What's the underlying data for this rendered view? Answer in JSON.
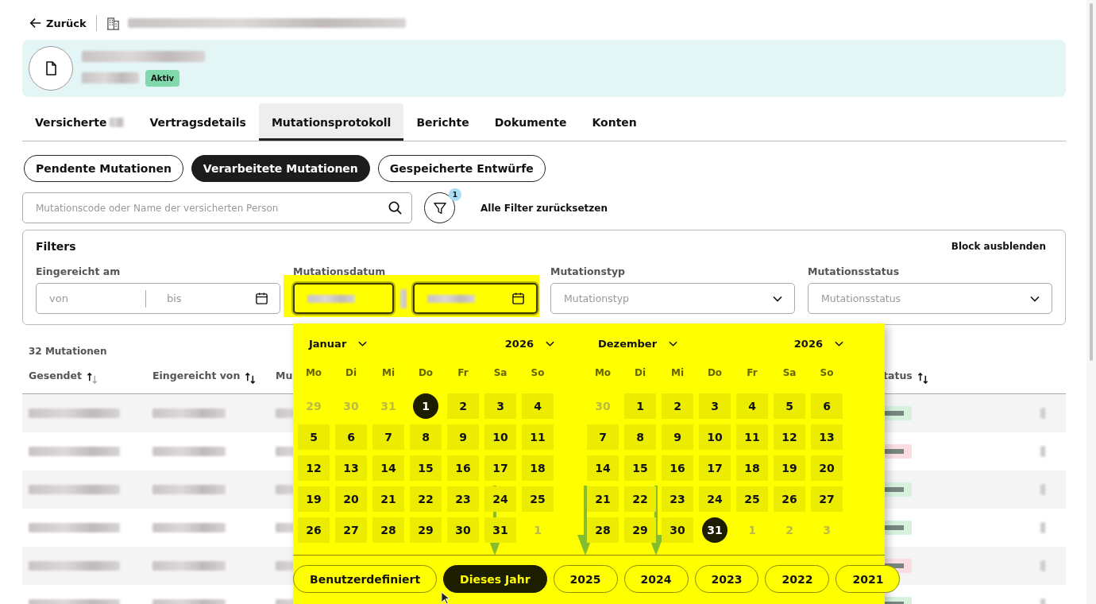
{
  "back_link": {
    "label": "Zurück"
  },
  "header": {
    "status_badge": "Aktiv"
  },
  "tabs": [
    {
      "label": "Versicherte",
      "count_redacted": true,
      "selected": false
    },
    {
      "label": "Vertragsdetails",
      "count_redacted": false,
      "selected": false
    },
    {
      "label": "Mutationsprotokoll",
      "count_redacted": false,
      "selected": true
    },
    {
      "label": "Berichte",
      "count_redacted": false,
      "selected": false
    },
    {
      "label": "Dokumente",
      "count_redacted": false,
      "selected": false
    },
    {
      "label": "Konten",
      "count_redacted": false,
      "selected": false
    }
  ],
  "view_toggle": [
    {
      "label": "Pendente Mutationen",
      "selected": false
    },
    {
      "label": "Verarbeitete Mutationen",
      "selected": true
    },
    {
      "label": "Gespeicherte Entwürfe",
      "selected": false
    }
  ],
  "search": {
    "placeholder": "Mutationscode oder Name der versicherten Person"
  },
  "filter_button": {
    "badge": "1"
  },
  "reset_link": "Alle Filter zurücksetzen",
  "filters": {
    "title": "Filters",
    "hide_link": "Block ausblenden",
    "fields": [
      {
        "kind": "range",
        "label": "Eingereicht am",
        "from_placeholder": "von",
        "to_placeholder": "bis",
        "highlighted": false
      },
      {
        "kind": "range_filled",
        "label": "Mutationsdatum",
        "highlighted": true
      },
      {
        "kind": "select",
        "label": "Mutationstyp",
        "placeholder": "Mutationstyp"
      },
      {
        "kind": "select",
        "label": "Mutationsstatus",
        "placeholder": "Mutationsstatus"
      }
    ]
  },
  "table": {
    "count": "32 Mutationen",
    "columns": [
      {
        "label": "Gesendet",
        "sorted": true
      },
      {
        "label": "Eingereicht von",
        "sorted": false
      },
      {
        "label": "Mu"
      },
      {
        "label": "tatus",
        "sorted": false
      }
    ],
    "rows": [
      {
        "color": "#d6f2dc"
      },
      {
        "color": "#f9dde2"
      },
      {
        "color": "#d6f2dc"
      },
      {
        "color": "#d6f2dc"
      },
      {
        "color": "#f9dde2"
      },
      {
        "color": "#d6f2dc"
      }
    ]
  },
  "datepicker": {
    "months": [
      {
        "month": "Januar",
        "year": "2026",
        "weekdays": [
          "Mo",
          "Di",
          "Mi",
          "Do",
          "Fr",
          "Sa",
          "So"
        ],
        "weeks": [
          [
            {
              "label": "29",
              "outside": true,
              "selected": false
            },
            {
              "label": "30",
              "outside": true,
              "selected": false
            },
            {
              "label": "31",
              "outside": true,
              "selected": false
            },
            {
              "label": "1",
              "outside": false,
              "selected": true
            },
            {
              "label": "2",
              "outside": false,
              "selected": false
            },
            {
              "label": "3",
              "outside": false,
              "selected": false
            },
            {
              "label": "4",
              "outside": false,
              "selected": false
            }
          ],
          [
            {
              "label": "5",
              "outside": false,
              "selected": false
            },
            {
              "label": "6",
              "outside": false,
              "selected": false
            },
            {
              "label": "7",
              "outside": false,
              "selected": false
            },
            {
              "label": "8",
              "outside": false,
              "selected": false
            },
            {
              "label": "9",
              "outside": false,
              "selected": false
            },
            {
              "label": "10",
              "outside": false,
              "selected": false
            },
            {
              "label": "11",
              "outside": false,
              "selected": false
            }
          ],
          [
            {
              "label": "12",
              "outside": false,
              "selected": false
            },
            {
              "label": "13",
              "outside": false,
              "selected": false
            },
            {
              "label": "14",
              "outside": false,
              "selected": false
            },
            {
              "label": "15",
              "outside": false,
              "selected": false
            },
            {
              "label": "16",
              "outside": false,
              "selected": false
            },
            {
              "label": "17",
              "outside": false,
              "selected": false
            },
            {
              "label": "18",
              "outside": false,
              "selected": false
            }
          ],
          [
            {
              "label": "19",
              "outside": false,
              "selected": false
            },
            {
              "label": "20",
              "outside": false,
              "selected": false
            },
            {
              "label": "21",
              "outside": false,
              "selected": false
            },
            {
              "label": "22",
              "outside": false,
              "selected": false
            },
            {
              "label": "23",
              "outside": false,
              "selected": false
            },
            {
              "label": "24",
              "outside": false,
              "selected": false
            },
            {
              "label": "25",
              "outside": false,
              "selected": false
            }
          ],
          [
            {
              "label": "26",
              "outside": false,
              "selected": false
            },
            {
              "label": "27",
              "outside": false,
              "selected": false
            },
            {
              "label": "28",
              "outside": false,
              "selected": false
            },
            {
              "label": "29",
              "outside": false,
              "selected": false
            },
            {
              "label": "30",
              "outside": false,
              "selected": false
            },
            {
              "label": "31",
              "outside": false,
              "selected": false
            },
            {
              "label": "1",
              "outside": true,
              "selected": false
            }
          ]
        ]
      },
      {
        "month": "Dezember",
        "year": "2026",
        "weekdays": [
          "Mo",
          "Di",
          "Mi",
          "Do",
          "Fr",
          "Sa",
          "So"
        ],
        "weeks": [
          [
            {
              "label": "30",
              "outside": true,
              "selected": false
            },
            {
              "label": "1",
              "outside": false,
              "selected": false
            },
            {
              "label": "2",
              "outside": false,
              "selected": false
            },
            {
              "label": "3",
              "outside": false,
              "selected": false
            },
            {
              "label": "4",
              "outside": false,
              "selected": false
            },
            {
              "label": "5",
              "outside": false,
              "selected": false
            },
            {
              "label": "6",
              "outside": false,
              "selected": false
            }
          ],
          [
            {
              "label": "7",
              "outside": false,
              "selected": false
            },
            {
              "label": "8",
              "outside": false,
              "selected": false
            },
            {
              "label": "9",
              "outside": false,
              "selected": false
            },
            {
              "label": "10",
              "outside": false,
              "selected": false
            },
            {
              "label": "11",
              "outside": false,
              "selected": false
            },
            {
              "label": "12",
              "outside": false,
              "selected": false
            },
            {
              "label": "13",
              "outside": false,
              "selected": false
            }
          ],
          [
            {
              "label": "14",
              "outside": false,
              "selected": false
            },
            {
              "label": "15",
              "outside": false,
              "selected": false
            },
            {
              "label": "16",
              "outside": false,
              "selected": false
            },
            {
              "label": "17",
              "outside": false,
              "selected": false
            },
            {
              "label": "18",
              "outside": false,
              "selected": false
            },
            {
              "label": "19",
              "outside": false,
              "selected": false
            },
            {
              "label": "20",
              "outside": false,
              "selected": false
            }
          ],
          [
            {
              "label": "21",
              "outside": false,
              "selected": false
            },
            {
              "label": "22",
              "outside": false,
              "selected": false
            },
            {
              "label": "23",
              "outside": false,
              "selected": false
            },
            {
              "label": "24",
              "outside": false,
              "selected": false
            },
            {
              "label": "25",
              "outside": false,
              "selected": false
            },
            {
              "label": "26",
              "outside": false,
              "selected": false
            },
            {
              "label": "27",
              "outside": false,
              "selected": false
            }
          ],
          [
            {
              "label": "28",
              "outside": false,
              "selected": false
            },
            {
              "label": "29",
              "outside": false,
              "selected": false
            },
            {
              "label": "30",
              "outside": false,
              "selected": false
            },
            {
              "label": "31",
              "outside": false,
              "selected": true
            },
            {
              "label": "1",
              "outside": true,
              "selected": false
            },
            {
              "label": "2",
              "outside": true,
              "selected": false
            },
            {
              "label": "3",
              "outside": true,
              "selected": false
            }
          ]
        ]
      }
    ],
    "presets": [
      {
        "label": "Benutzerdefiniert",
        "selected": false,
        "marked": false
      },
      {
        "label": "Dieses Jahr",
        "selected": true,
        "marked": true
      },
      {
        "label": "2025",
        "selected": false,
        "marked": true
      },
      {
        "label": "2024",
        "selected": false,
        "marked": true
      },
      {
        "label": "2023",
        "selected": false,
        "marked": false
      },
      {
        "label": "2022",
        "selected": false,
        "marked": false
      },
      {
        "label": "2021",
        "selected": false,
        "marked": false
      }
    ]
  }
}
